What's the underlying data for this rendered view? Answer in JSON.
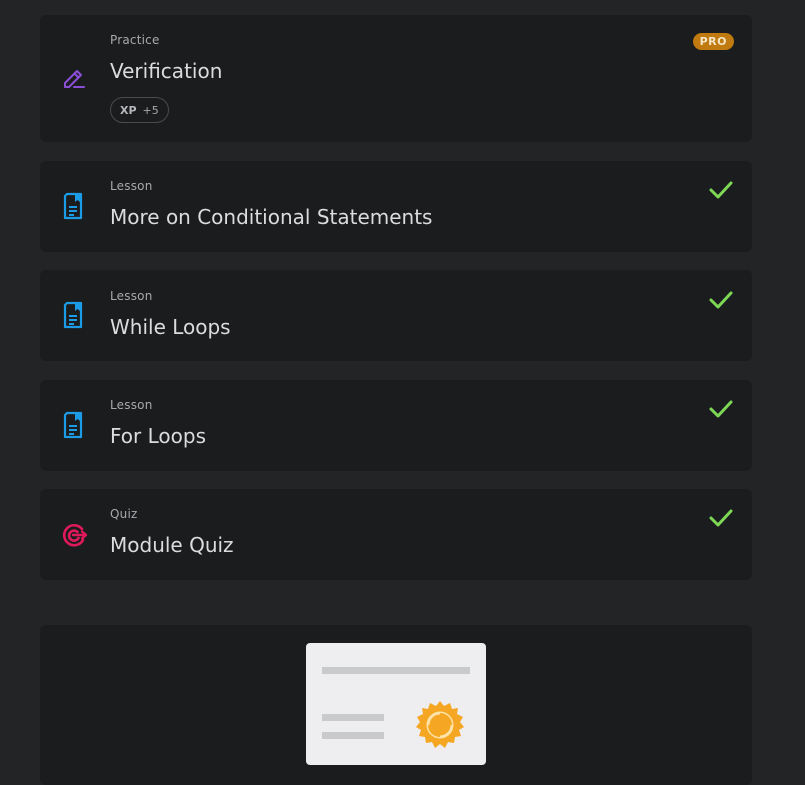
{
  "items": [
    {
      "kind": "Practice",
      "title": "Verification",
      "icon": "pencil-edit-icon",
      "badge": "PRO",
      "xp_label": "XP",
      "xp_value": "+5"
    },
    {
      "kind": "Lesson",
      "title": "More on Conditional Statements",
      "icon": "document-bookmark-icon",
      "completed": true
    },
    {
      "kind": "Lesson",
      "title": "While Loops",
      "icon": "document-bookmark-icon",
      "completed": true
    },
    {
      "kind": "Lesson",
      "title": "For Loops",
      "icon": "document-bookmark-icon",
      "completed": true
    },
    {
      "kind": "Quiz",
      "title": "Module Quiz",
      "icon": "target-icon",
      "completed": true
    }
  ],
  "colors": {
    "background": "#232426",
    "card": "#1b1c1e",
    "practice_icon": "#8a4fd6",
    "lesson_icon": "#1c9be6",
    "quiz_icon": "#e0195a",
    "check": "#7dd855",
    "pro_badge": "#c07a10",
    "seal": "#f5a623"
  },
  "certificate": {
    "icon": "certificate-icon"
  }
}
